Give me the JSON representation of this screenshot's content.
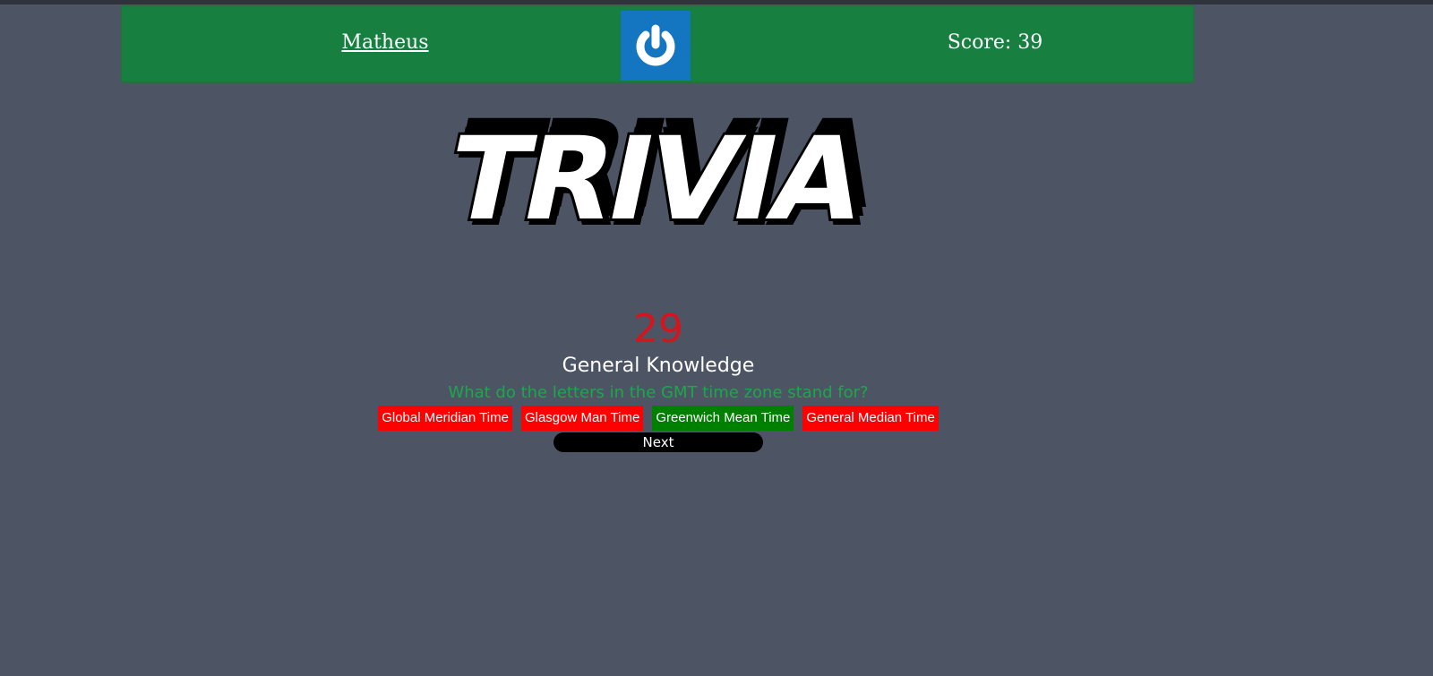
{
  "header": {
    "username": "Matheus",
    "score_text": "Score: 39",
    "logout_icon": "power-icon"
  },
  "logo": {
    "text": "TRIVIA"
  },
  "game": {
    "timer": "29",
    "category": "General Knowledge",
    "question": "What do the letters in the GMT time zone stand for?",
    "answers": [
      {
        "label": "Global Meridian Time",
        "status": "wrong"
      },
      {
        "label": "Glasgow Man Time",
        "status": "wrong"
      },
      {
        "label": "Greenwich Mean Time",
        "status": "correct"
      },
      {
        "label": "General Median Time",
        "status": "wrong"
      }
    ],
    "next_label": "Next"
  },
  "colors": {
    "background": "#4d5564",
    "header_bg": "#178040",
    "timer": "#d5141d",
    "question": "#1ba84a",
    "wrong_answer": "#ff0000",
    "correct_answer": "#008000"
  }
}
